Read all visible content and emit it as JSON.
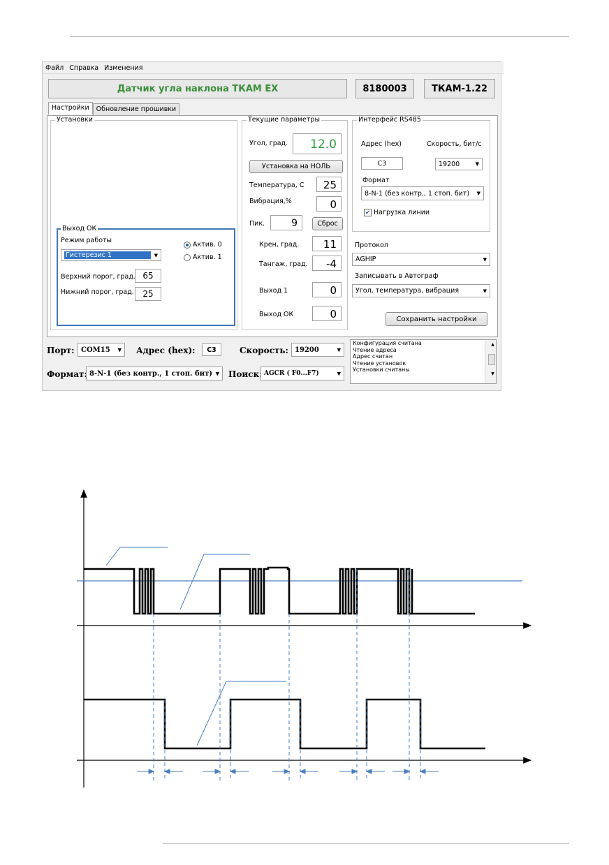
{
  "window": {
    "menu": [
      "Файл",
      "Справка",
      "Изменения"
    ],
    "title": "Датчик угла наклона ТКАМ EX",
    "serial": "8180003",
    "model": "ТКАМ-1.22",
    "tabs": [
      {
        "label": "Настройки",
        "active": true
      },
      {
        "label": "Обновление прошивки",
        "active": false
      }
    ]
  },
  "settings": {
    "legend": "Установки",
    "output_ok": {
      "legend": "Выход ОК",
      "mode_label": "Режим работы",
      "mode_value": "Гистерезис 1",
      "radio_active0": "Актив. 0",
      "radio_active1": "Актив. 1",
      "upper_label": "Верхний порог, град.",
      "upper_value": "65",
      "lower_label": "Нижний порог, град.",
      "lower_value": "25"
    }
  },
  "current": {
    "legend": "Текущие параметры",
    "angle_label": "Угол, град.",
    "angle_value": "12.0",
    "zero_button": "Установка на НОЛЬ",
    "temp_label": "Температура, С",
    "temp_value": "25",
    "vib_label": "Вибрация,%",
    "vib_value": "0",
    "peak_label": "Пик.",
    "peak_value": "9",
    "reset_button": "Сброс",
    "roll_label": "Крен, град.",
    "roll_value": "11",
    "pitch_label": "Тангаж, град.",
    "pitch_value": "-4",
    "out1_label": "Выход 1",
    "out1_value": "0",
    "outok_label": "Выход ОК",
    "outok_value": "0"
  },
  "rs485": {
    "legend": "Интерфейс RS485",
    "addr_label": "Адрес (hex)",
    "addr_value": "C3",
    "speed_label": "Скорость, бит/с",
    "speed_value": "19200",
    "format_label": "Формат",
    "format_value": "8-N-1 (без контр., 1 стоп. бит)",
    "load_label": "Нагрузка линии",
    "load_checked": true
  },
  "protocol": {
    "label": "Протокол",
    "value": "AGHIP",
    "record_label": "Записывать в Автограф",
    "record_value": "Угол, температура, вибрация",
    "save_button": "Сохранить настройки"
  },
  "bottom": {
    "port_label": "Порт:",
    "port_value": "COM15",
    "addr_label": "Адрес (hex):",
    "addr_value": "C3",
    "speed_label": "Скорость:",
    "speed_value": "19200",
    "format_label": "Формат:",
    "format_value": "8-N-1 (без контр., 1 стоп. бит)",
    "search_label": "Поиск:",
    "search_value": "AGCR ( F0...F7)",
    "log": [
      "Конфигурация считана",
      "Чтение адреса",
      "Адрес считан",
      "Чтение установок",
      "Установки считаны"
    ]
  },
  "colors": {
    "title_green": "#3a8f3a",
    "angle_green": "#2e9a3e",
    "diagram_blue": "#4a7fc0"
  }
}
